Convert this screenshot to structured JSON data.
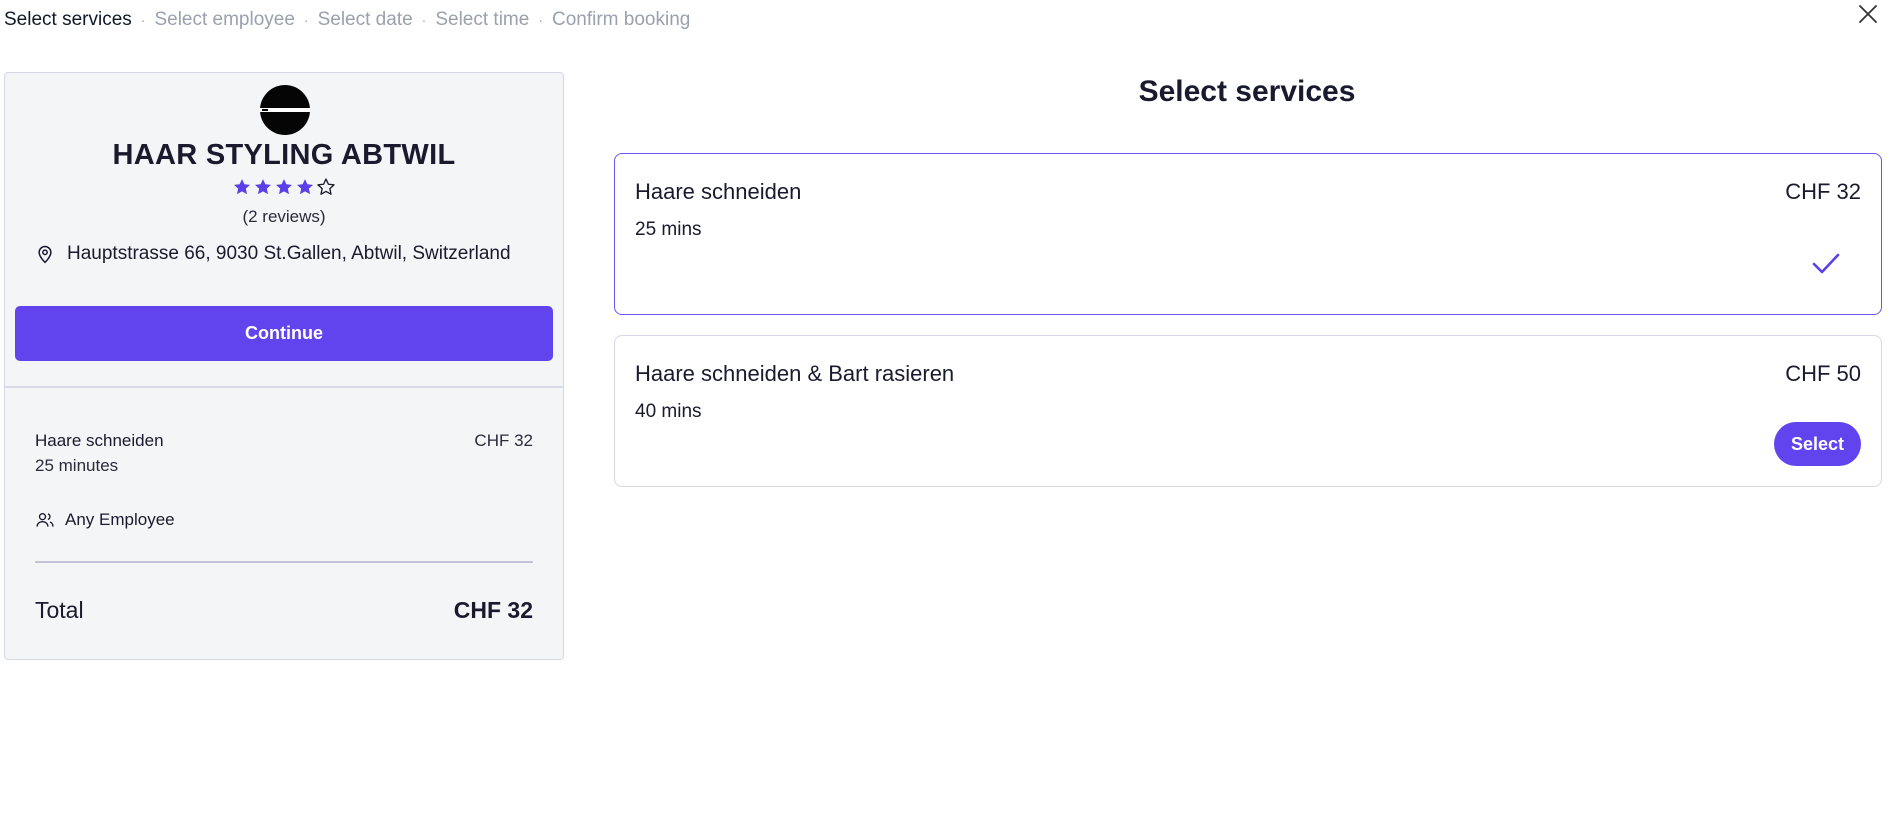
{
  "breadcrumb": {
    "steps": [
      "Select services",
      "Select employee",
      "Select date",
      "Select time",
      "Confirm booking"
    ],
    "separator": "·"
  },
  "close": {
    "icon": "close-icon"
  },
  "shop": {
    "logo_icon": "shop-logo",
    "name": "HAAR STYLING ABTWIL",
    "rating": 4,
    "rating_max": 5,
    "reviews": "(2 reviews)",
    "address_icon": "location-pin-icon",
    "address": "Hauptstrasse 66, 9030 St.Gallen, Abtwil, Switzerland"
  },
  "continue_label": "Continue",
  "summary": {
    "service_name": "Haare schneiden",
    "service_price": "CHF 32",
    "service_duration": "25 minutes",
    "employee_icon": "users-icon",
    "employee": "Any Employee",
    "total_label": "Total",
    "total_value": "CHF 32"
  },
  "services_section": {
    "title": "Select services",
    "items": [
      {
        "name": "Haare schneiden",
        "price": "CHF 32",
        "duration": "25 mins",
        "selected": true
      },
      {
        "name": "Haare schneiden & Bart rasieren",
        "price": "CHF 50",
        "duration": "40 mins",
        "selected": false,
        "button_label": "Select"
      }
    ]
  },
  "colors": {
    "accent": "#6244ef",
    "star": "#5b3fe8",
    "card_bg": "#f4f5f7",
    "border": "#d6d8e6",
    "muted_text": "#9aa0ae"
  }
}
